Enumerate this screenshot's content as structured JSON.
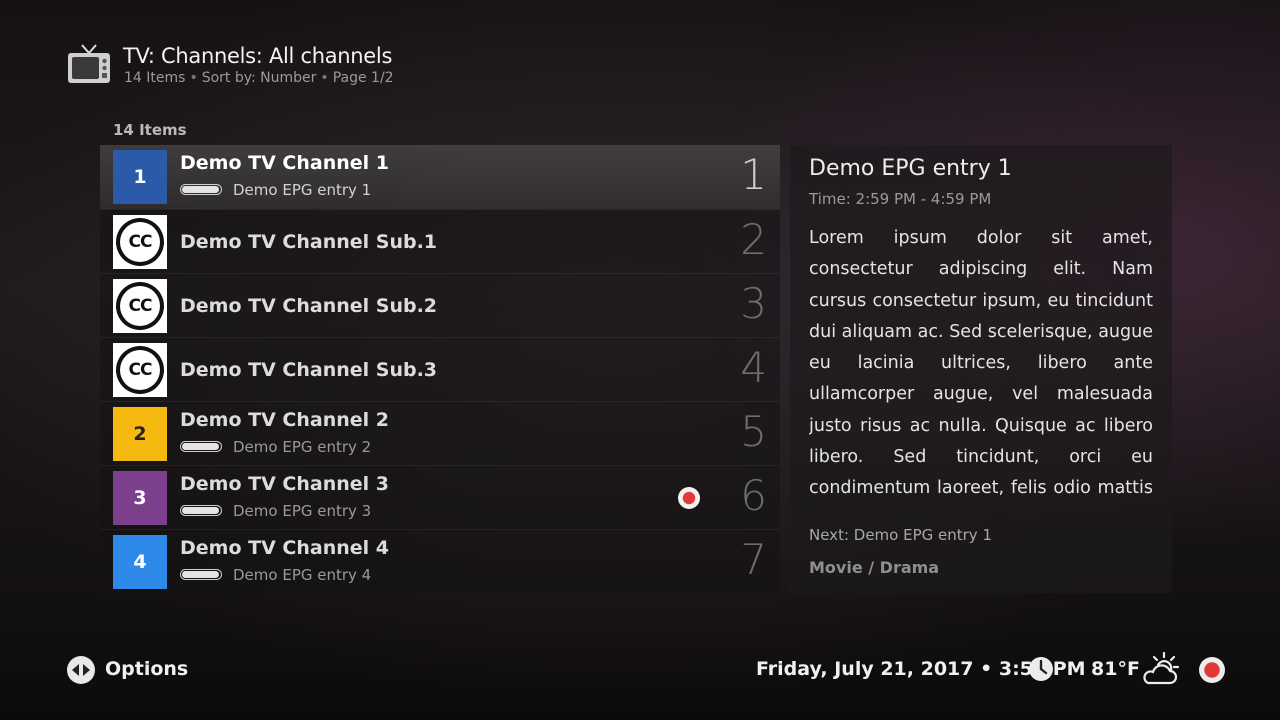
{
  "header": {
    "icon": "tv-icon",
    "title": "TV: Channels: All channels",
    "sub_items": "14 Items",
    "sub_sort": "Sort by: Number",
    "sub_page": "Page 1/2"
  },
  "list": {
    "count_label": "14 Items",
    "rows": [
      {
        "name": "Demo TV Channel 1",
        "epg": "Demo EPG entry 1",
        "progress": 0.95,
        "number": "1",
        "logo_text": "1",
        "logo_color": "#2a5aa8",
        "focused": true
      },
      {
        "name": "Demo TV Channel Sub.1",
        "number": "2",
        "logo_text": "CC",
        "logo": "cc-logo-icon"
      },
      {
        "name": "Demo TV Channel Sub.2",
        "number": "3",
        "logo_text": "CC",
        "logo": "cc-logo-icon"
      },
      {
        "name": "Demo TV Channel Sub.3",
        "number": "4",
        "logo_text": "CC",
        "logo": "cc-logo-icon"
      },
      {
        "name": "Demo TV Channel 2",
        "epg": "Demo EPG entry 2",
        "progress": 0.95,
        "number": "5",
        "logo_text": "2",
        "logo_color": "#f5b90f",
        "logo_text_color": "#222222"
      },
      {
        "name": "Demo TV Channel 3",
        "epg": "Demo EPG entry 3",
        "progress": 0.95,
        "number": "6",
        "logo_text": "3",
        "logo_color": "#7b3f8c",
        "recording": true
      },
      {
        "name": "Demo TV Channel 4",
        "epg": "Demo EPG entry 4",
        "progress": 0.95,
        "number": "7",
        "logo_text": "4",
        "logo_color": "#2d8ae8"
      }
    ]
  },
  "info": {
    "title": "Demo EPG entry 1",
    "time": "Time: 2:59 PM - 4:59 PM",
    "plot": "Lorem ipsum dolor sit amet, consectetur adipiscing elit. Nam cursus consectetur ipsum, eu tincidunt dui aliquam ac. Sed scelerisque, augue eu lacinia ultrices, libero ante ullamcorper augue, vel malesuada justo risus ac nulla. Quisque ac libero libero. Sed tincidunt, orci eu condimentum laoreet, felis odio mattis est, et lacinia metus enim in leo. Fusce",
    "next": "Next: Demo EPG entry 1",
    "genre": "Movie / Drama"
  },
  "footer": {
    "options_icon": "left-right-arrows-icon",
    "options_label": "Options",
    "datetime": "Friday, July 21, 2017 • 3:56 PM",
    "clock_icon": "clock-icon",
    "temperature": "81°F",
    "weather_icon": "partly-cloudy-icon",
    "record_icon": "record-icon"
  }
}
